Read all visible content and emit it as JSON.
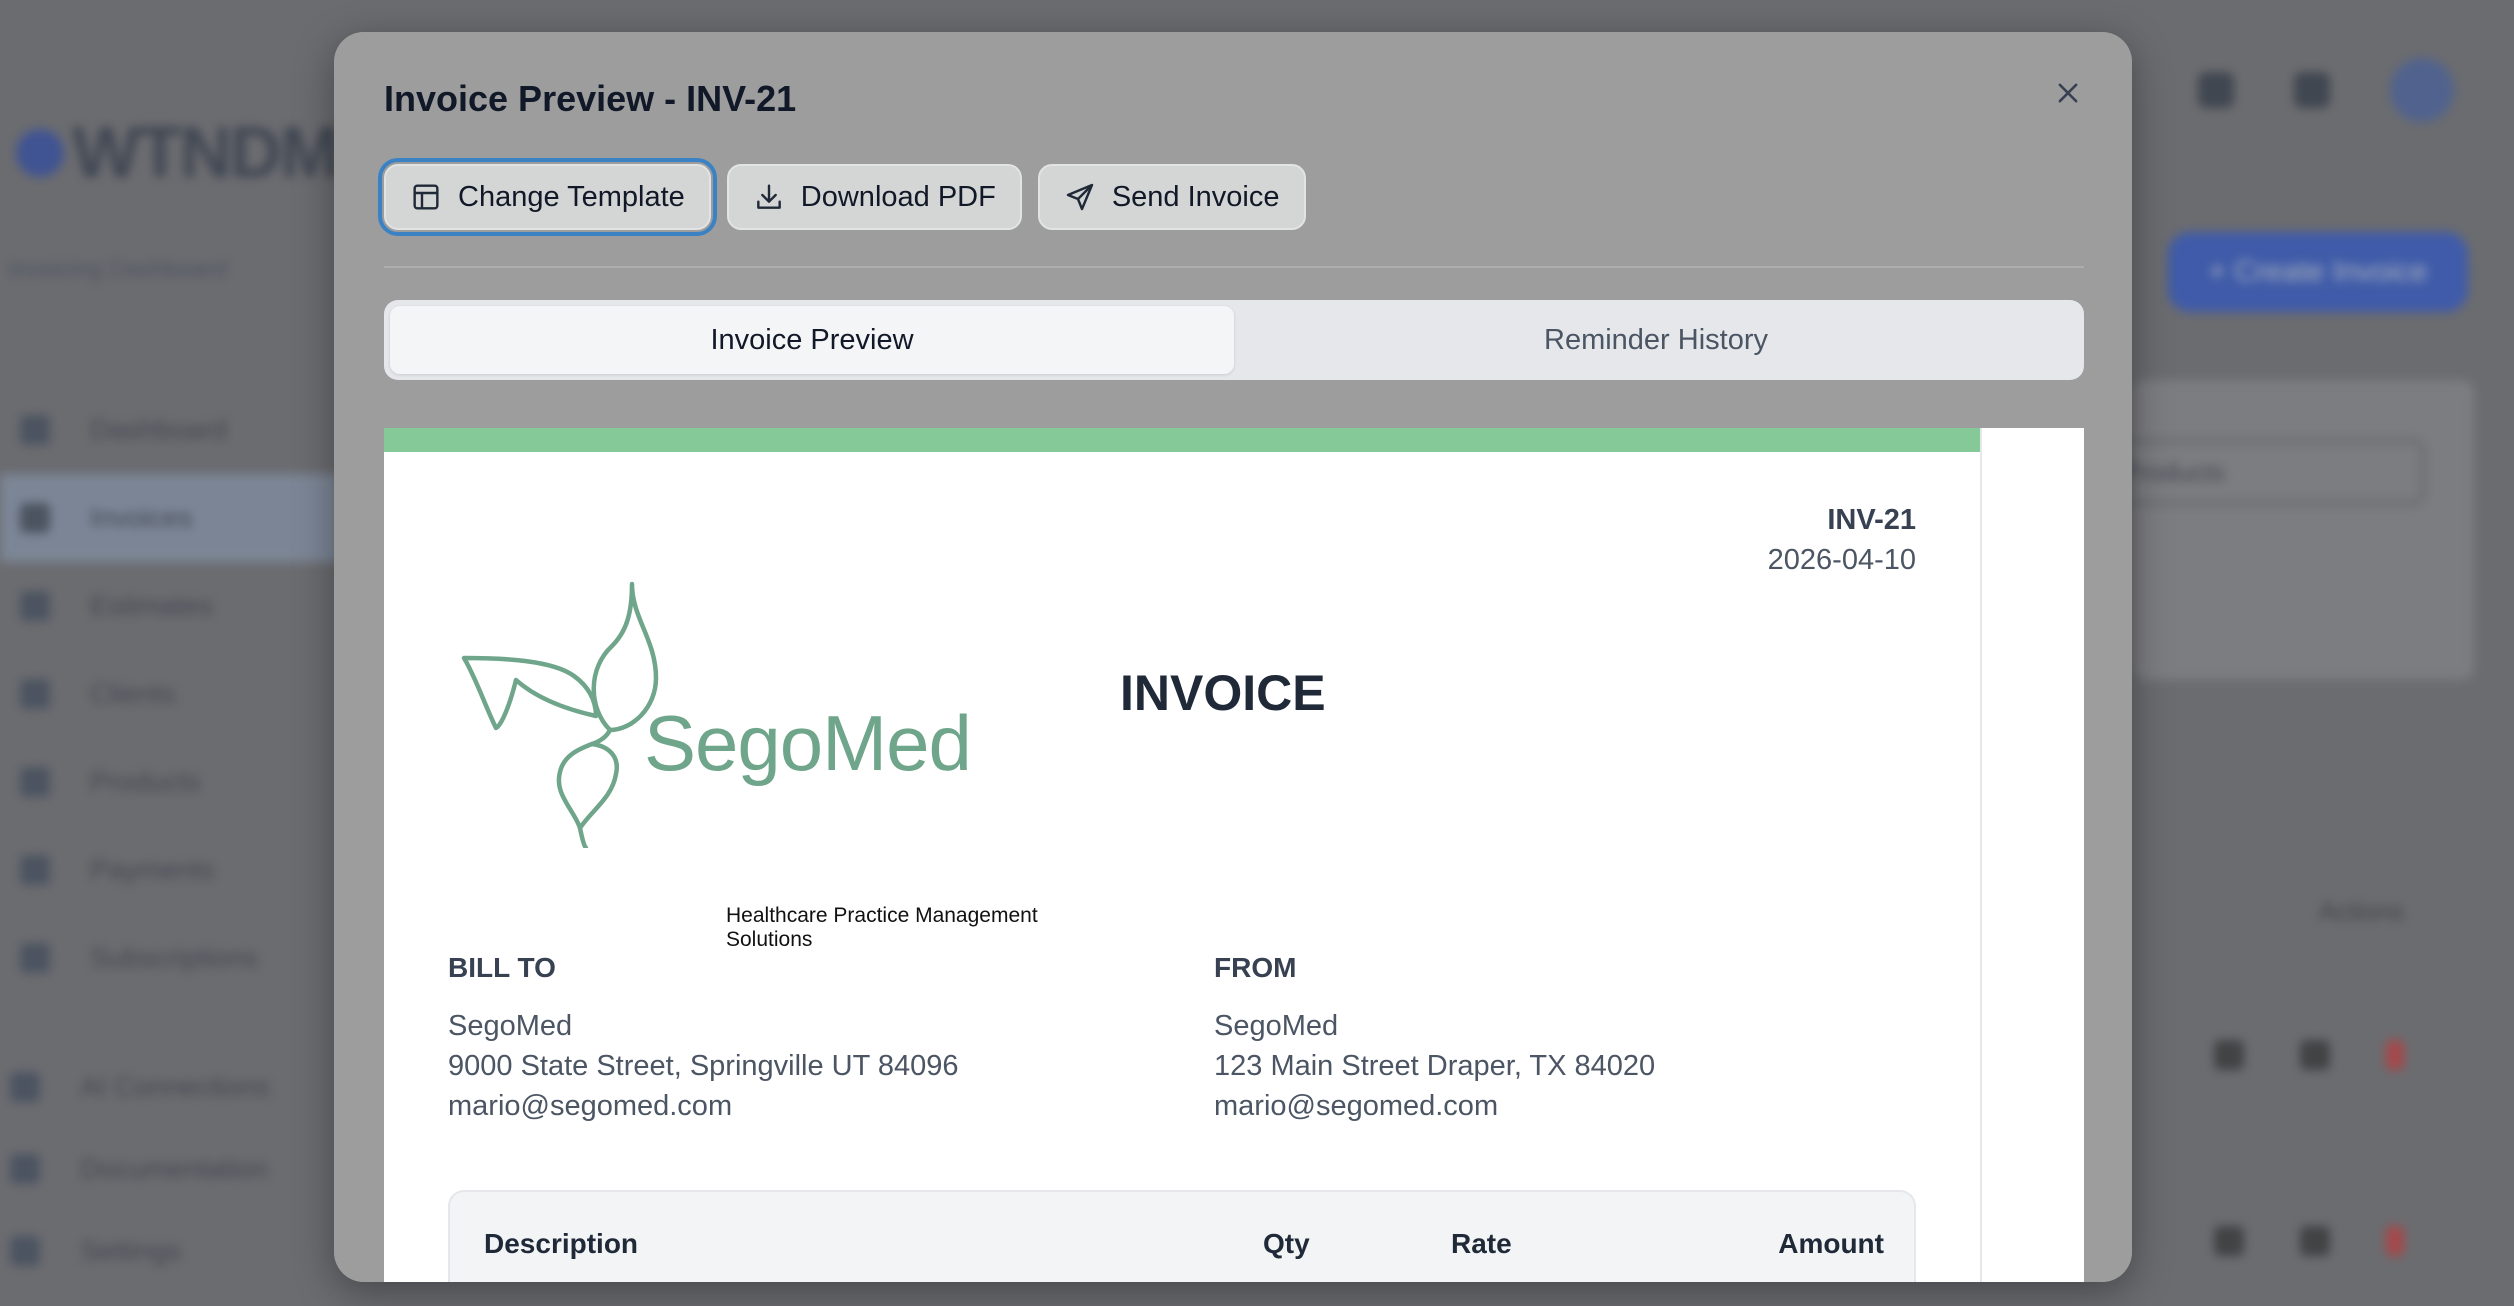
{
  "background": {
    "logo_text": "WTNDM",
    "subtitle": "Invoicing Dashboard",
    "nav_items": [
      "Dashboard",
      "Invoices",
      "Estimates",
      "Clients",
      "Products",
      "Payments",
      "Subscriptions"
    ],
    "nav_bottom": [
      "AI Connections",
      "Documentation",
      "Settings"
    ],
    "create_button": "+ Create Invoice",
    "select_value": "Products",
    "actions_label": "Actions"
  },
  "modal": {
    "title": "Invoice Preview - INV-21",
    "close_icon": "close-icon",
    "toolbar": {
      "change_template": "Change Template",
      "download_pdf": "Download PDF",
      "send_invoice": "Send Invoice"
    },
    "tabs": [
      {
        "label": "Invoice Preview",
        "active": true
      },
      {
        "label": "Reminder History",
        "active": false
      }
    ]
  },
  "invoice": {
    "accent_color": "#86c998",
    "number": "INV-21",
    "date": "2026-04-10",
    "heading": "INVOICE",
    "logo": {
      "name": "SegoMed",
      "tagline": "Healthcare Practice Management Solutions",
      "color": "#6fa58a"
    },
    "bill_to": {
      "label": "BILL TO",
      "name": "SegoMed",
      "address": "9000 State Street, Springville UT 84096",
      "email": "mario@segomed.com"
    },
    "from": {
      "label": "FROM",
      "name": "SegoMed",
      "address": "123 Main Street Draper, TX 84020",
      "email": "mario@segomed.com"
    },
    "table": {
      "headers": {
        "description": "Description",
        "qty": "Qty",
        "rate": "Rate",
        "amount": "Amount"
      }
    }
  }
}
